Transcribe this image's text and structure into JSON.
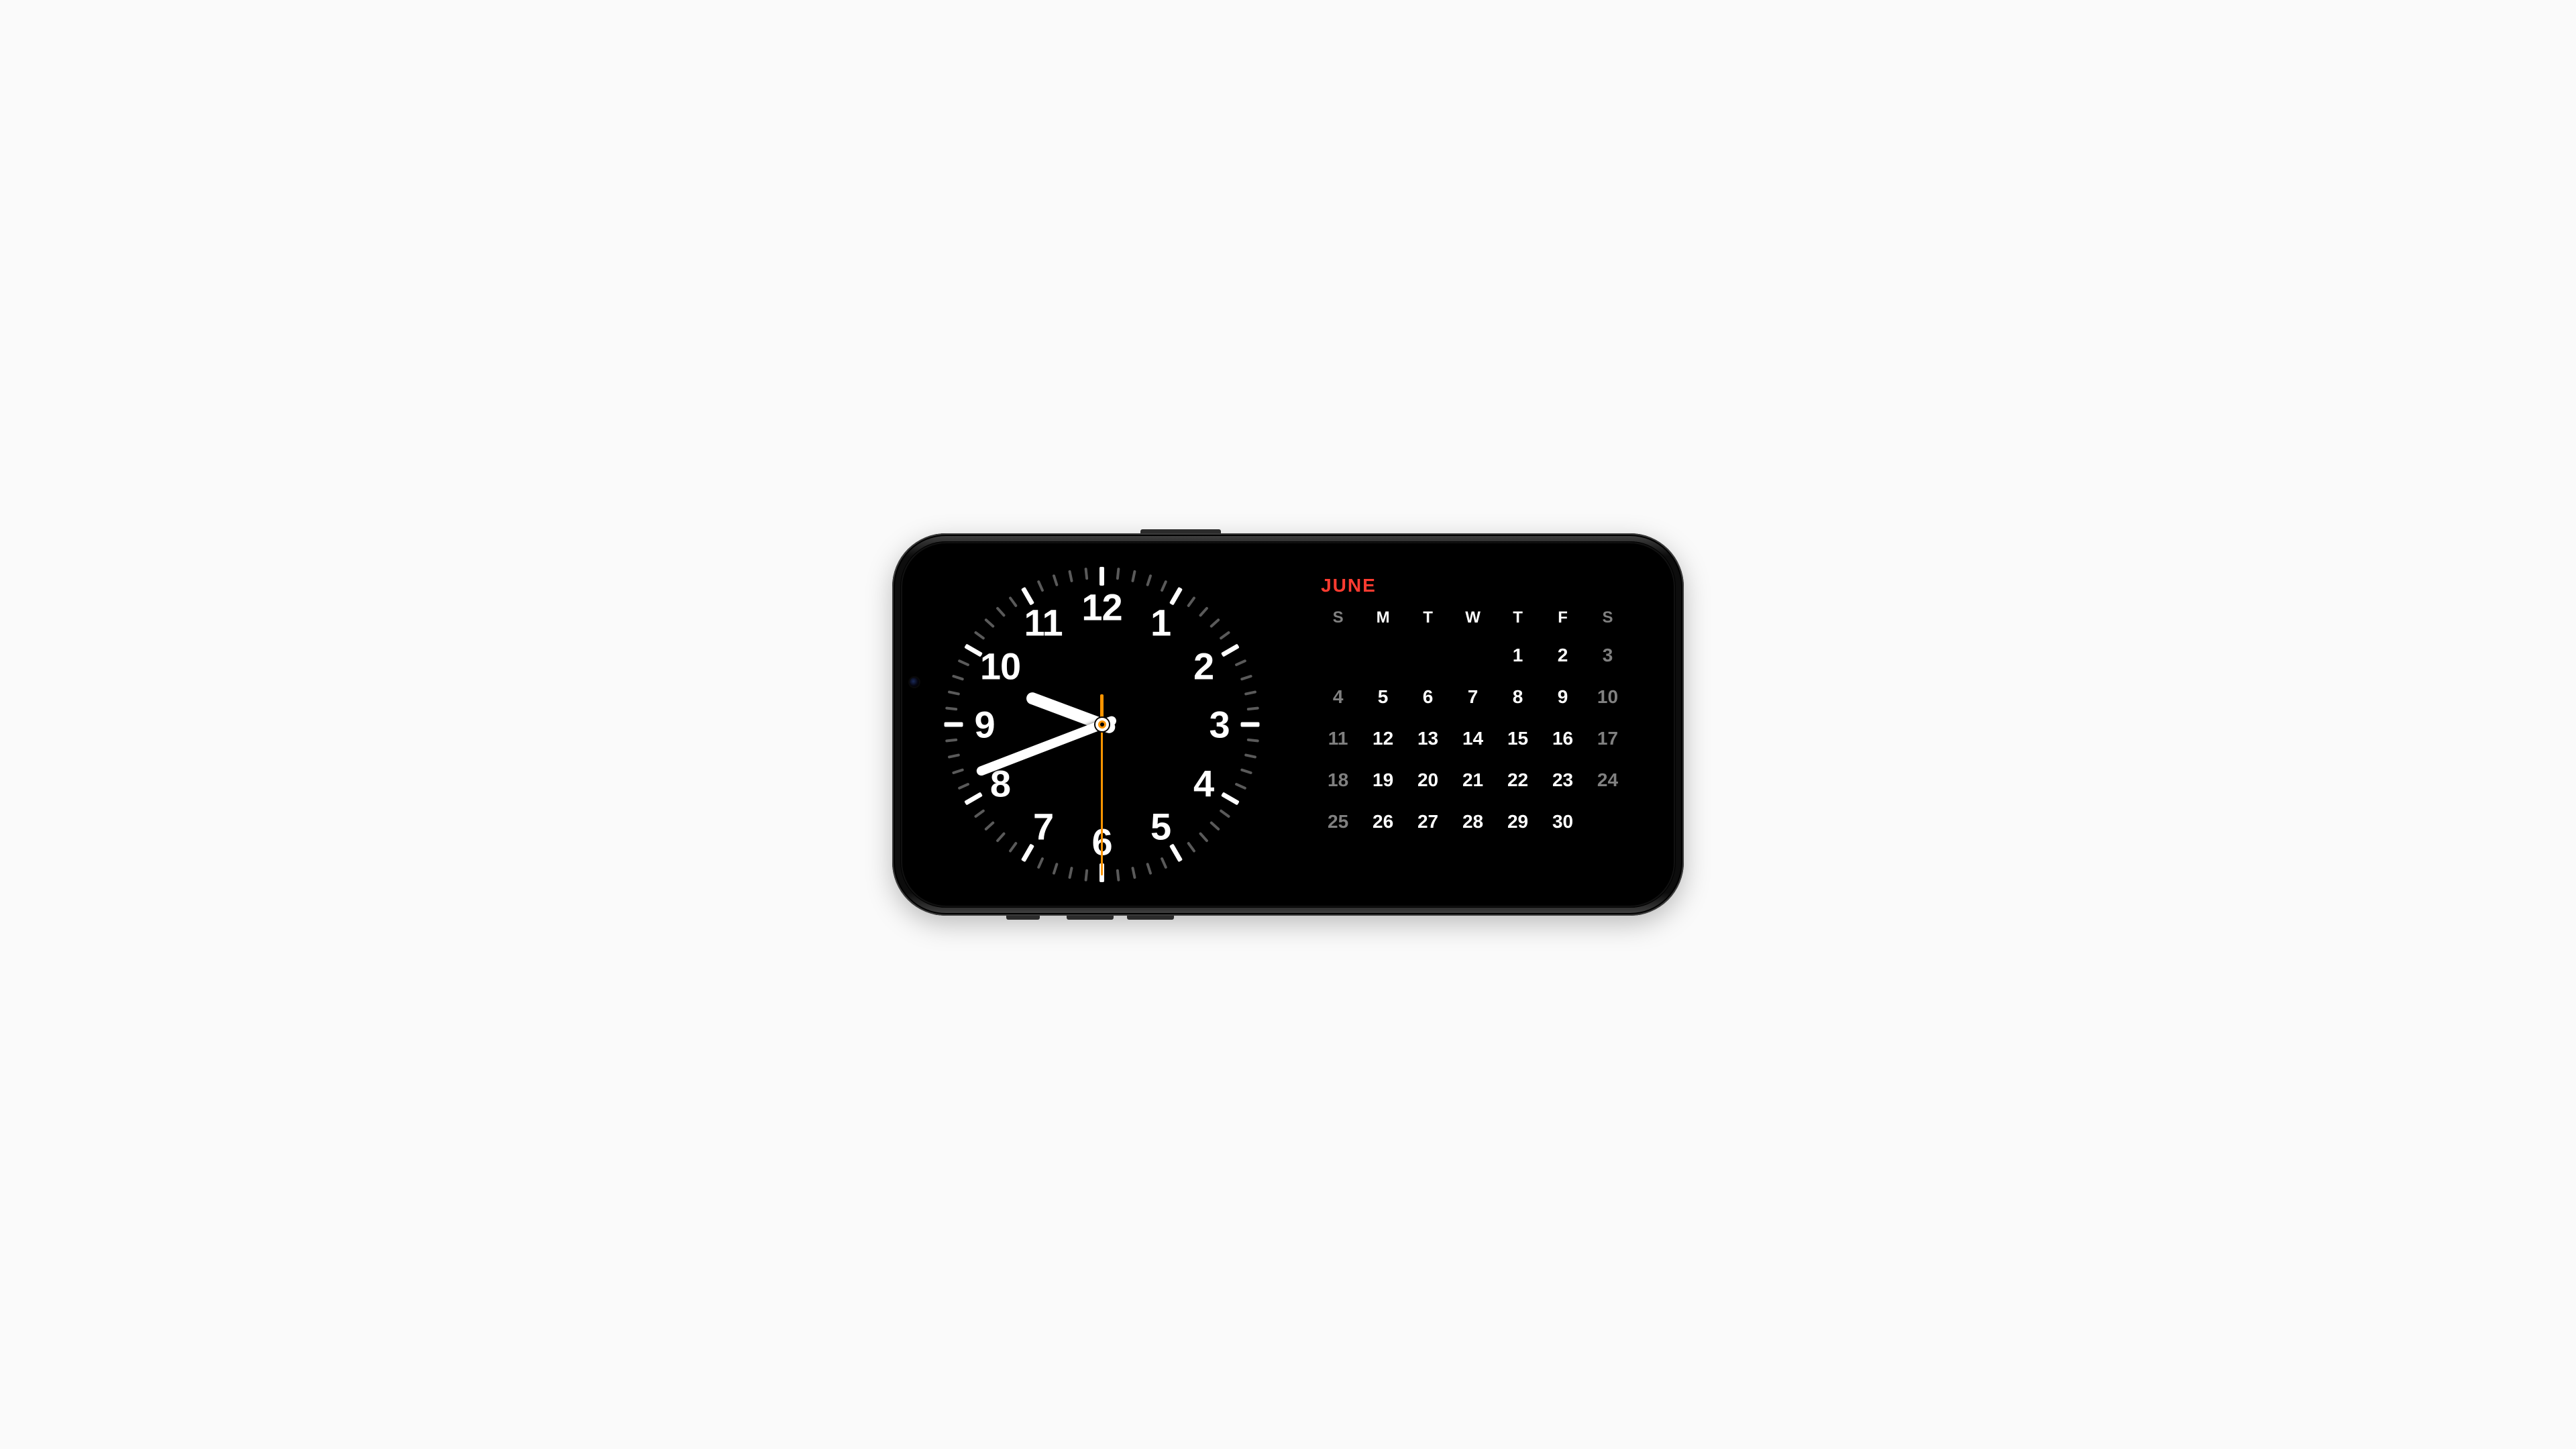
{
  "clock": {
    "numerals": [
      "12",
      "1",
      "2",
      "3",
      "4",
      "5",
      "6",
      "7",
      "8",
      "9",
      "10",
      "11"
    ],
    "time": {
      "hours": 9,
      "minutes": 41,
      "seconds": 30
    }
  },
  "calendar": {
    "month_label": "JUNE",
    "days_of_week": [
      "S",
      "M",
      "T",
      "W",
      "T",
      "F",
      "S"
    ],
    "first_weekday_index": 4,
    "days_in_month": 30,
    "today": 5,
    "weekend_columns": [
      0,
      6
    ]
  },
  "colors": {
    "accent": "#ff3b30",
    "second_hand": "#ff9500"
  }
}
